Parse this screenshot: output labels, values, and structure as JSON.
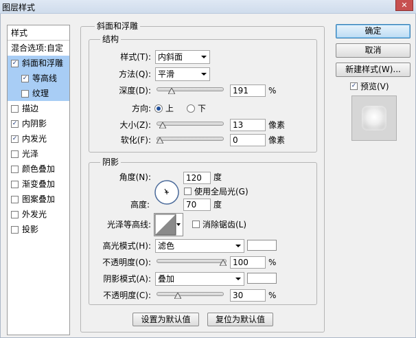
{
  "window": {
    "title": "图层样式",
    "close_glyph": "✕"
  },
  "list": {
    "header": "样式",
    "items": [
      {
        "label": "混合选项:自定",
        "checkbox": false,
        "checked": false,
        "selected": false
      },
      {
        "label": "斜面和浮雕",
        "checkbox": true,
        "checked": true,
        "selected": true
      },
      {
        "label": "等高线",
        "checkbox": true,
        "checked": true,
        "selected": true,
        "indent": true
      },
      {
        "label": "纹理",
        "checkbox": true,
        "checked": false,
        "selected": true,
        "indent": true
      },
      {
        "label": "描边",
        "checkbox": true,
        "checked": false,
        "selected": false
      },
      {
        "label": "内阴影",
        "checkbox": true,
        "checked": true,
        "selected": false
      },
      {
        "label": "内发光",
        "checkbox": true,
        "checked": true,
        "selected": false
      },
      {
        "label": "光泽",
        "checkbox": true,
        "checked": false,
        "selected": false
      },
      {
        "label": "颜色叠加",
        "checkbox": true,
        "checked": false,
        "selected": false
      },
      {
        "label": "渐变叠加",
        "checkbox": true,
        "checked": false,
        "selected": false
      },
      {
        "label": "图案叠加",
        "checkbox": true,
        "checked": false,
        "selected": false
      },
      {
        "label": "外发光",
        "checkbox": true,
        "checked": false,
        "selected": false
      },
      {
        "label": "投影",
        "checkbox": true,
        "checked": false,
        "selected": false
      }
    ]
  },
  "bevel": {
    "section_title": "斜面和浮雕",
    "structure": {
      "title": "结构",
      "style_label": "样式(T):",
      "style_value": "内斜面",
      "technique_label": "方法(Q):",
      "technique_value": "平滑",
      "depth_label": "深度(D):",
      "depth_value": "191",
      "depth_unit": "%",
      "depth_fraction": 0.19,
      "direction_label": "方向:",
      "direction_up": "上",
      "direction_down": "下",
      "size_label": "大小(Z):",
      "size_value": "13",
      "size_unit": "像素",
      "size_fraction": 0.05,
      "soften_label": "软化(F):",
      "soften_value": "0",
      "soften_unit": "像素",
      "soften_fraction": 0
    },
    "shading": {
      "title": "阴影",
      "angle_label": "角度(N):",
      "angle_value": "120",
      "angle_unit": "度",
      "global_light_label": "使用全局光(G)",
      "altitude_label": "高度:",
      "altitude_value": "70",
      "altitude_unit": "度",
      "gloss_label": "光泽等高线:",
      "antialias_label": "消除锯齿(L)",
      "highlight_mode_label": "高光模式(H):",
      "highlight_mode_value": "滤色",
      "highlight_color": "#ffffff",
      "highlight_opacity_label": "不透明度(O):",
      "highlight_opacity_value": "100",
      "highlight_opacity_unit": "%",
      "highlight_opacity_fraction": 1.0,
      "shadow_mode_label": "阴影模式(A):",
      "shadow_mode_value": "叠加",
      "shadow_color": "#ffffff",
      "shadow_opacity_label": "不透明度(C):",
      "shadow_opacity_value": "30",
      "shadow_opacity_unit": "%",
      "shadow_opacity_fraction": 0.3
    },
    "make_default_label": "设置为默认值",
    "reset_default_label": "复位为默认值"
  },
  "actions": {
    "ok_label": "确定",
    "cancel_label": "取消",
    "new_style_label": "新建样式(W)...",
    "preview_label": "预览(V)",
    "preview_checked": true
  }
}
